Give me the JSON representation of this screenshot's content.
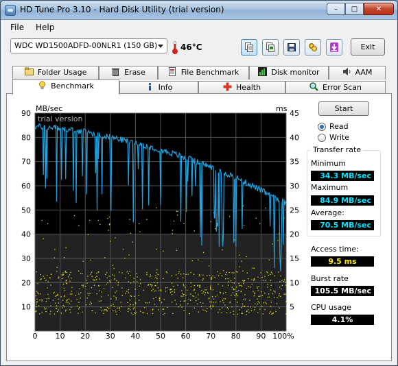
{
  "window": {
    "title": "HD Tune Pro 3.10 - Hard Disk Utility (trial version)",
    "controls": [
      "minimize",
      "maximize",
      "close"
    ]
  },
  "menu": {
    "file": "File",
    "help": "Help"
  },
  "toolbar": {
    "drive": "WDC WD1500ADFD-00NLR1 (150 GB)",
    "temperature": "46°C",
    "exit_label": "Exit",
    "icons": [
      "copy-text-icon",
      "copy-screenshot-icon",
      "save-icon",
      "options-icon",
      "download-icon"
    ]
  },
  "tabs_top": [
    {
      "label": "Folder Usage",
      "icon": "folder-usage-icon"
    },
    {
      "label": "Erase",
      "icon": "trash-icon"
    },
    {
      "label": "File Benchmark",
      "icon": "file-benchmark-icon"
    },
    {
      "label": "Disk monitor",
      "icon": "disk-monitor-icon"
    },
    {
      "label": "AAM",
      "icon": "speaker-icon"
    }
  ],
  "tabs_bottom": [
    {
      "label": "Benchmark",
      "icon": "bulb-icon",
      "selected": true
    },
    {
      "label": "Info",
      "icon": "info-icon"
    },
    {
      "label": "Health",
      "icon": "health-cross-icon"
    },
    {
      "label": "Error Scan",
      "icon": "magnifier-icon"
    }
  ],
  "controls": {
    "start_label": "Start",
    "read_label": "Read",
    "write_label": "Write",
    "read_selected": true
  },
  "stats": {
    "transfer_rate_title": "Transfer rate",
    "minimum_label": "Minimum",
    "minimum_value": "34.3 MB/sec",
    "maximum_label": "Maximum",
    "maximum_value": "84.9 MB/sec",
    "average_label": "Average:",
    "average_value": "70.5 MB/sec",
    "access_time_label": "Access time:",
    "access_time_value": "9.5 ms",
    "burst_rate_label": "Burst rate",
    "burst_rate_value": "105.5 MB/sec",
    "cpu_usage_label": "CPU usage",
    "cpu_usage_value": "4.1%"
  },
  "chart_data": {
    "type": "line",
    "title": "",
    "watermark": "trial version",
    "y_left_unit": "MB/sec",
    "y_right_unit": "ms",
    "x_ticks": [
      "0",
      "10",
      "20",
      "30",
      "40",
      "50",
      "60",
      "70",
      "80",
      "90",
      "100%"
    ],
    "y_left_ticks": [
      "90",
      "80",
      "70",
      "60",
      "50",
      "40",
      "30",
      "20",
      "10"
    ],
    "y_right_ticks": [
      "45",
      "40",
      "35",
      "30",
      "25",
      "20",
      "15",
      "10",
      "5"
    ],
    "ylim_left": [
      0,
      90
    ],
    "ylim_right": [
      0,
      45
    ],
    "xlim": [
      0,
      100
    ],
    "grid": true,
    "colors": {
      "transfer": "#1fa3df",
      "access": "#e8e800",
      "plot_bg": "#000000"
    },
    "series": [
      {
        "name": "Transfer rate",
        "x": [
          0,
          2,
          4,
          6,
          8,
          10,
          12,
          14,
          16,
          18,
          20,
          22,
          24,
          26,
          28,
          30,
          32,
          34,
          36,
          38,
          40,
          42,
          44,
          46,
          48,
          50,
          52,
          54,
          56,
          58,
          60,
          62,
          64,
          66,
          68,
          70,
          72,
          74,
          76,
          78,
          80,
          82,
          84,
          86,
          88,
          90,
          92,
          94,
          96,
          98,
          100
        ],
        "values": [
          84.5,
          84.4,
          84.2,
          84.0,
          84.1,
          83.8,
          83.5,
          83.2,
          82.8,
          82.5,
          82.3,
          81.8,
          81.3,
          80.9,
          80.5,
          80.1,
          79.6,
          79.1,
          78.6,
          78.2,
          77.7,
          77.2,
          76.6,
          76.0,
          75.4,
          74.8,
          74.2,
          73.6,
          72.9,
          72.2,
          71.5,
          70.9,
          70.1,
          69.4,
          68.6,
          67.8,
          67.0,
          66.1,
          65.2,
          64.3,
          63.4,
          62.4,
          61.3,
          60.3,
          59.2,
          58.1,
          57.0,
          55.8,
          54.5,
          53.9,
          52.9
        ]
      },
      {
        "name": "Access time",
        "unit": "ms",
        "summary": "scatter of access-time samples, mostly between 4 ms and 13 ms"
      }
    ]
  }
}
